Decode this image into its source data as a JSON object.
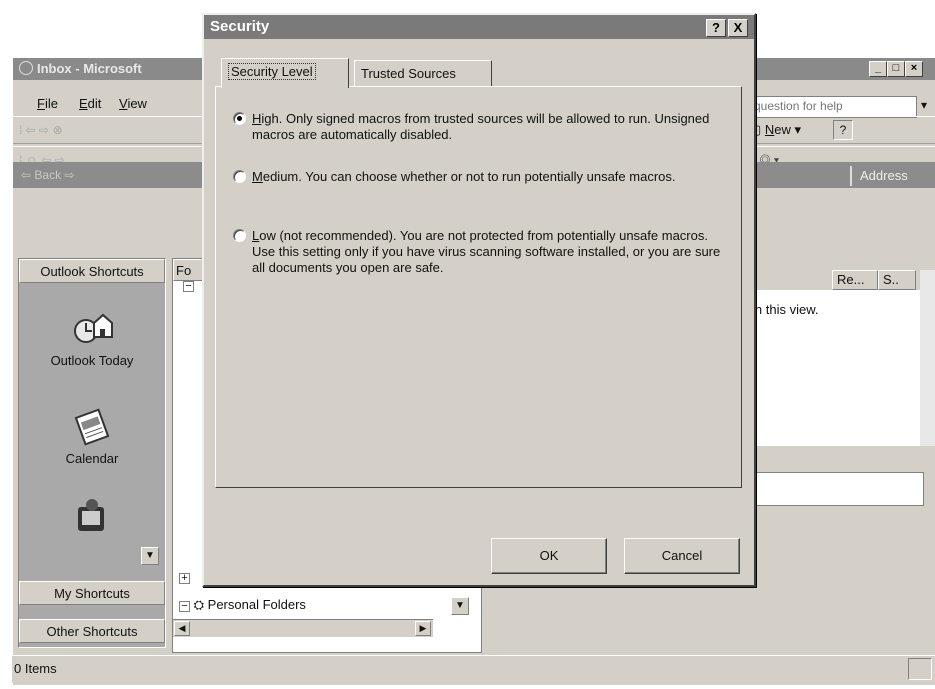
{
  "outlook": {
    "title": "Inbox - Microsoft",
    "menu": [
      {
        "label": "File",
        "underline": "F"
      },
      {
        "label": "Edit",
        "underline": "E"
      },
      {
        "label": "View",
        "underline": "V"
      }
    ],
    "help_placeholder": "question for help",
    "toolbar_new": "New",
    "nav_back": "Back",
    "address_label": "Address",
    "folder_header_abbrev": "Fo",
    "column_headers": [
      "Re...",
      "S.."
    ],
    "empty_message": "in this view.",
    "shortcuts": {
      "header": "Outlook Shortcuts",
      "items": [
        {
          "label": "Outlook Today",
          "icon": "outlook-today-icon"
        },
        {
          "label": "Calendar",
          "icon": "calendar-icon"
        },
        {
          "label": "",
          "icon": "contacts-icon"
        }
      ],
      "groups": [
        "My Shortcuts",
        "Other Shortcuts"
      ]
    },
    "folders": {
      "personal_folders": "Personal Folders"
    },
    "status": "0 Items"
  },
  "dialog": {
    "title": "Security",
    "help_button": "?",
    "close_button": "X",
    "tabs": [
      {
        "label": "Security Level",
        "active": true
      },
      {
        "label": "Trusted Sources",
        "active": false
      }
    ],
    "options": [
      {
        "key": "H",
        "rest": "igh. Only signed macros from trusted sources will be allowed to run. Unsigned macros are automatically disabled.",
        "checked": true
      },
      {
        "key": "M",
        "rest": "edium. You can choose whether or not to run potentially unsafe macros.",
        "checked": false
      },
      {
        "key": "L",
        "rest": "ow (not recommended). You are not protected from potentially unsafe macros. Use this setting only if you have virus scanning software installed, or you are sure all documents you open are safe.",
        "checked": false
      }
    ],
    "ok_label": "OK",
    "cancel_label": "Cancel"
  }
}
